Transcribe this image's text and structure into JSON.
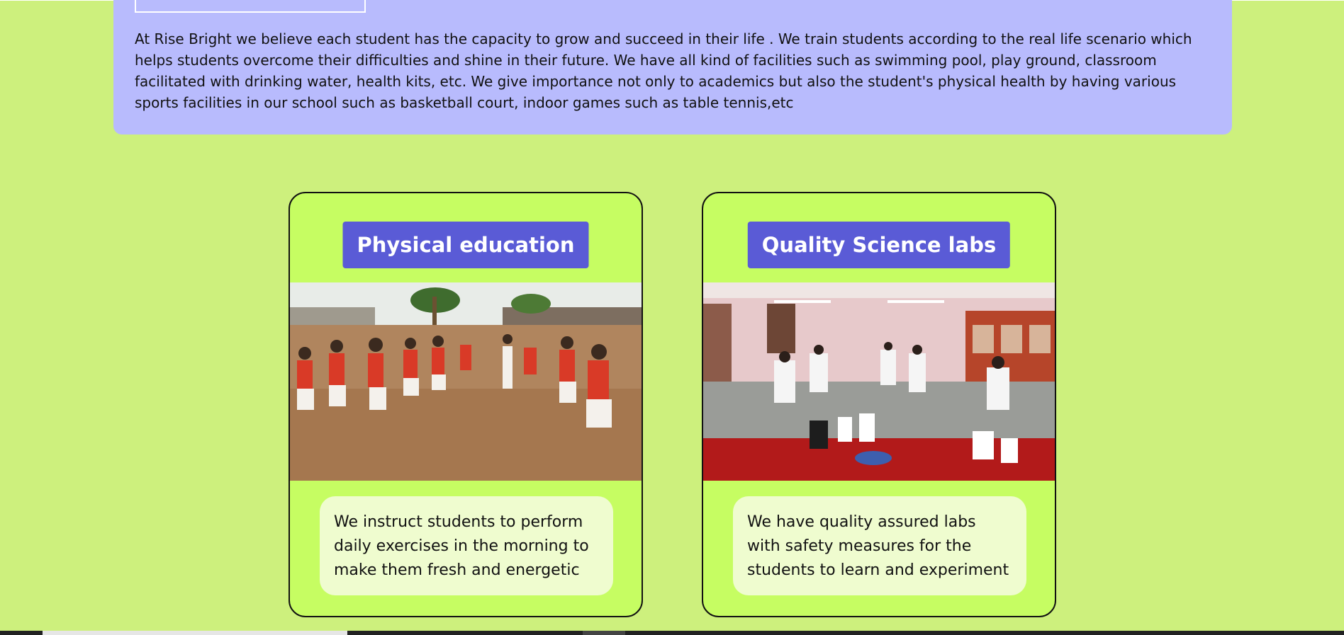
{
  "about": {
    "text": "At Rise Bright we believe each student has the capacity to grow and succeed in their life . We train students according to the real life scenario which helps students overcome their difficulties and shine in their future. We have all kind of facilities such as swimming pool, play ground, classroom facilitated with drinking water, health kits, etc. We give importance not only to academics but also the student's physical health by having various sports facilities in our school such as basketball court, indoor games such as table tennis,etc"
  },
  "cards": [
    {
      "title": "Physical education",
      "image": "students-exercising-photo",
      "description": "We instruct students to perform daily exercises in the morning to make them fresh and energetic"
    },
    {
      "title": "Quality Science labs",
      "image": "science-lab-photo",
      "description": "We have quality assured labs with safety measures for the students to learn and experiment"
    }
  ],
  "colors": {
    "page_background": "#cdf07d",
    "about_background": "#b8bbfd",
    "card_background": "#c6fd62",
    "title_background": "#5a5bd6",
    "description_background": "#effccf"
  }
}
